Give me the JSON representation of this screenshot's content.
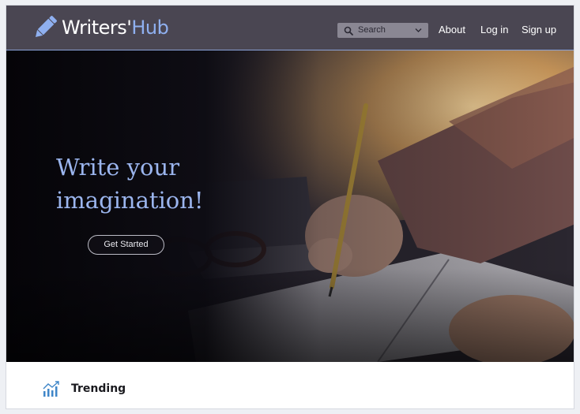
{
  "brand": {
    "name_part1": "Writers'",
    "name_part2": "Hub",
    "logo_icon": "pencil-icon"
  },
  "header": {
    "search": {
      "label": "Search",
      "icon": "search-icon"
    },
    "nav": [
      {
        "label": "About"
      },
      {
        "label": "Log in"
      },
      {
        "label": "Sign up"
      }
    ]
  },
  "hero": {
    "title_line1": "Write your",
    "title_line2": "imagination!",
    "cta_label": "Get Started",
    "image": "hand-writing-in-notebook-photo"
  },
  "trending": {
    "label": "Trending",
    "icon": "trending-chart-icon"
  },
  "colors": {
    "header_bg": "#4a4652",
    "accent": "#8fb0f0",
    "hero_title": "#9bb5ee",
    "page_bg": "#eef0f4"
  }
}
